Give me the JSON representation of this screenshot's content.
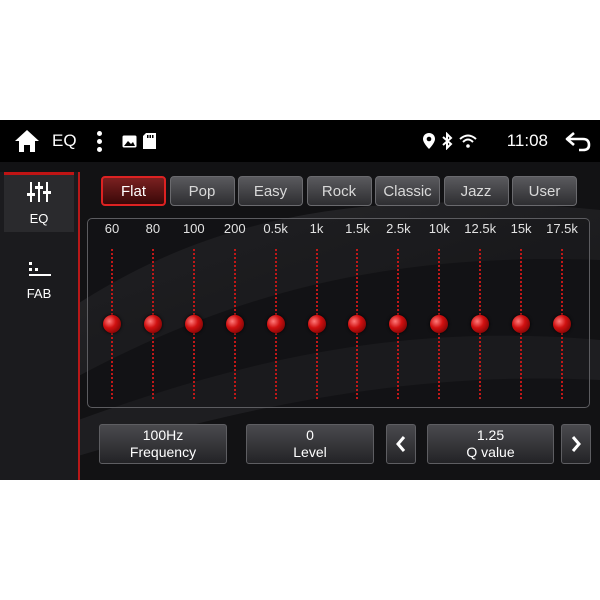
{
  "statusbar": {
    "app_title": "EQ",
    "time": "11:08",
    "icons": [
      "home-icon",
      "menu-dots-icon",
      "gallery-icon",
      "sd-card-icon",
      "location-icon",
      "bluetooth-icon",
      "wifi-icon",
      "back-icon"
    ]
  },
  "sidebar": {
    "items": [
      {
        "label": "EQ",
        "icon": "equalizer-sliders-icon",
        "active": true
      },
      {
        "label": "FAB",
        "icon": "fader-balance-icon",
        "active": false
      }
    ]
  },
  "presets": {
    "items": [
      "Flat",
      "Pop",
      "Easy",
      "Rock",
      "Classic",
      "Jazz",
      "User"
    ],
    "selected": "Flat"
  },
  "eq": {
    "bands": [
      {
        "freq": "60",
        "level": 0
      },
      {
        "freq": "80",
        "level": 0
      },
      {
        "freq": "100",
        "level": 0
      },
      {
        "freq": "200",
        "level": 0
      },
      {
        "freq": "0.5k",
        "level": 0
      },
      {
        "freq": "1k",
        "level": 0
      },
      {
        "freq": "1.5k",
        "level": 0
      },
      {
        "freq": "2.5k",
        "level": 0
      },
      {
        "freq": "10k",
        "level": 0
      },
      {
        "freq": "12.5k",
        "level": 0
      },
      {
        "freq": "15k",
        "level": 0
      },
      {
        "freq": "17.5k",
        "level": 0
      }
    ],
    "level_range": [
      -10,
      10
    ]
  },
  "params": {
    "frequency": {
      "value": "100Hz",
      "label": "Frequency"
    },
    "level": {
      "value": "0",
      "label": "Level"
    },
    "q": {
      "value": "1.25",
      "label": "Q value"
    }
  },
  "colors": {
    "accent": "#c01414",
    "statusbar_bg": "#000000",
    "screen_bg": "#121214"
  }
}
